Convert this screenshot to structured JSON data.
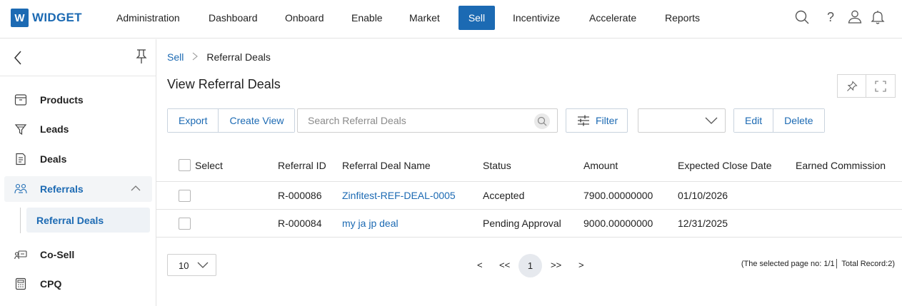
{
  "app": {
    "logo_letter": "W",
    "logo_text": "WIDGET",
    "accent_color": "#1c6ab3"
  },
  "nav": {
    "items": [
      "Administration",
      "Dashboard",
      "Onboard",
      "Enable",
      "Market",
      "Sell",
      "Incentivize",
      "Accelerate",
      "Reports"
    ],
    "active": "Sell",
    "icons": [
      "search-icon",
      "help-icon",
      "user-icon",
      "bell-icon"
    ],
    "help_glyph": "?"
  },
  "sidebar": {
    "items": [
      {
        "label": "Products",
        "icon": "box-icon"
      },
      {
        "label": "Leads",
        "icon": "funnel-icon"
      },
      {
        "label": "Deals",
        "icon": "document-icon"
      },
      {
        "label": "Referrals",
        "icon": "referrals-icon",
        "expanded": true
      },
      {
        "label": "Co-Sell",
        "icon": "co-sell-icon"
      },
      {
        "label": "CPQ",
        "icon": "calculator-icon"
      }
    ],
    "sub_items": [
      "Referral Deals"
    ]
  },
  "breadcrumb": {
    "parent": "Sell",
    "separator": ">",
    "current": "Referral Deals"
  },
  "page": {
    "title": "View Referral Deals"
  },
  "toolbar": {
    "export_label": "Export",
    "create_view_label": "Create View",
    "search_placeholder": "Search Referral Deals",
    "filter_label": "Filter",
    "view_select_value": "",
    "edit_label": "Edit",
    "delete_label": "Delete"
  },
  "table": {
    "columns": [
      "Select",
      "Referral ID",
      "Referral Deal Name",
      "Status",
      "Amount",
      "Expected Close Date",
      "Earned Commission"
    ],
    "rows": [
      {
        "referral_id": "R-000086",
        "name": "Zinfitest-REF-DEAL-0005",
        "status": "Accepted",
        "amount": "7900.00000000",
        "close_date": "01/10/2026",
        "commission": ""
      },
      {
        "referral_id": "R-000084",
        "name": "my ja jp deal",
        "status": "Pending Approval",
        "amount": "9000.00000000",
        "close_date": "12/31/2025",
        "commission": ""
      }
    ]
  },
  "pagination": {
    "page_size": "10",
    "prev": "<",
    "first": "<<",
    "current_page": "1",
    "last": ">>",
    "next": ">",
    "info": "(The selected page no: 1/1│ Total Record:2)"
  }
}
